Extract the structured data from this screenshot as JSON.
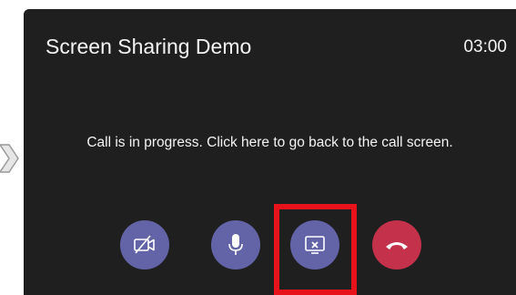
{
  "call": {
    "title": "Screen Sharing Demo",
    "timer": "03:00",
    "status_message": "Call is in progress. Click here to go back to the call screen."
  },
  "controls": [
    {
      "name": "video-off-button",
      "icon": "video-off-icon"
    },
    {
      "name": "microphone-button",
      "icon": "microphone-icon"
    },
    {
      "name": "stop-sharing-button",
      "icon": "stop-screen-share-icon",
      "highlighted": true
    },
    {
      "name": "hang-up-button",
      "icon": "phone-hangup-icon"
    }
  ],
  "colors": {
    "panel_background": "#201f1f",
    "control_purple": "#6264a7",
    "hangup_red": "#c4314b",
    "highlight_red": "#e8121b",
    "text": "#f4f4f4"
  }
}
